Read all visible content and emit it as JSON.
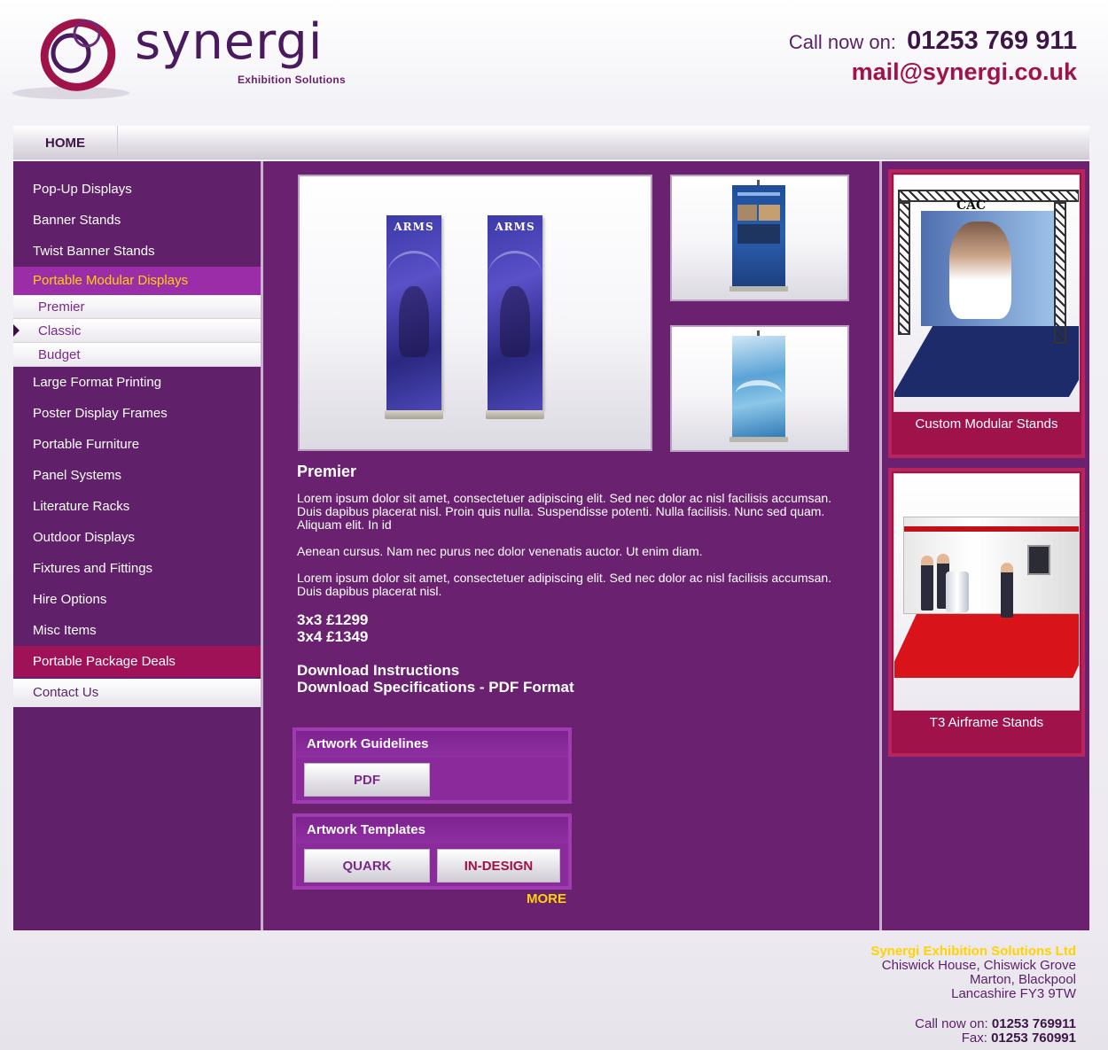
{
  "header": {
    "logo_text": "synergi",
    "logo_subtitle": "Exhibition Solutions",
    "call_label": "Call now on:",
    "call_number": "01253 769 911",
    "email": "mail@synergi.co.uk"
  },
  "nav": {
    "home_label": "HOME"
  },
  "sidebar": {
    "items": [
      "Pop-Up Displays",
      "Banner Stands",
      "Twist Banner Stands",
      "Portable Modular Displays",
      "Premier",
      "Classic",
      "Budget",
      "Large Format Printing",
      "Poster Display Frames",
      "Portable Furniture",
      "Panel Systems",
      "Literature Racks",
      "Outdoor Displays",
      "Fixtures and Fittings",
      "Hire Options",
      "Misc Items",
      "Portable Package Deals",
      "Contact Us"
    ]
  },
  "main": {
    "banner_brand": "ARMS",
    "title": "Premier",
    "paragraphs": [
      "Lorem ipsum dolor sit amet, consectetuer adipiscing elit. Sed nec dolor ac nisl facilisis accumsan. Duis dapibus placerat nisl. Proin quis nulla. Suspendisse potenti. Nulla facilisis. Nunc sed quam. Aliquam elit. In id",
      "Aenean cursus. Nam nec purus nec dolor venenatis auctor. Ut enim diam.",
      "Lorem ipsum dolor sit amet, consectetuer adipiscing elit. Sed nec dolor ac nisl facilisis accumsan. Duis dapibus placerat nisl."
    ],
    "prices": [
      "3x3 £1299",
      "3x4 £1349"
    ],
    "downloads": [
      "Download Instructions",
      "Download Specifications - PDF Format"
    ],
    "artwork_guidelines": {
      "title": "Artwork Guidelines",
      "pdf_label": "PDF"
    },
    "artwork_templates": {
      "title": "Artwork Templates",
      "quark_label": "QUARK",
      "indesign_label": "IN-DESIGN"
    },
    "more_label": "MORE"
  },
  "right": {
    "promo1": {
      "brand": "CAC",
      "caption": "Custom Modular Stands"
    },
    "promo2": {
      "caption": "T3 Airframe Stands"
    }
  },
  "footer": {
    "company": "Synergi Exhibition Solutions Ltd",
    "address": [
      "Chiswick House, Chiswick Grove",
      "Marton, Blackpool",
      "Lancashire FY3 9TW"
    ],
    "call_label": "Call now on:",
    "call_number": "01253 769911",
    "fax_label": "Fax:",
    "fax_number": "01253 760991"
  },
  "colors": {
    "brand_purple": "#6a2170",
    "accent_magenta": "#a0124a",
    "highlight_yellow": "#ffd200",
    "active_menu": "#9b2da9"
  }
}
